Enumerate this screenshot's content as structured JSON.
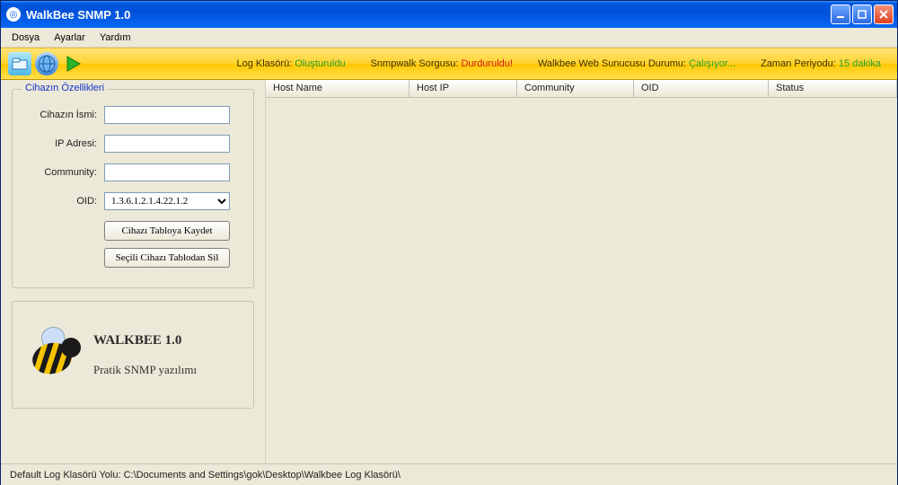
{
  "window": {
    "title": "WalkBee SNMP 1.0"
  },
  "menu": {
    "file": "Dosya",
    "settings": "Ayarlar",
    "help": "Yardım"
  },
  "toolbar": {
    "log_label": "Log Klasörü:",
    "log_value": "Oluşturuldu",
    "walk_label": "Snmpwalk Sorgusu:",
    "walk_value": "Durduruldu!",
    "web_label": "Walkbee Web Sunucusu Durumu:",
    "web_value": "Çalışıyor...",
    "period_label": "Zaman Periyodu:",
    "period_value": "15 dakika"
  },
  "form": {
    "group_title": "Cihazın Özellikleri",
    "name_label": "Cihazın İsmi:",
    "name_value": "",
    "ip_label": "IP Adresi:",
    "ip_value": "",
    "community_label": "Community:",
    "community_value": "",
    "oid_label": "OID:",
    "oid_value": "1.3.6.1.2.1.4.22.1.2",
    "save_btn": "Cihazı Tabloya Kaydet",
    "delete_btn": "Seçili Cihazı Tablodan Sil"
  },
  "branding": {
    "title": "WALKBEE 1.0",
    "subtitle": "Pratik SNMP yazılımı"
  },
  "table": {
    "columns": {
      "hostname": "Host Name",
      "hostip": "Host IP",
      "community": "Community",
      "oid": "OID",
      "status": "Status"
    }
  },
  "statusbar": {
    "text": "Default Log Klasörü Yolu: C:\\Documents and Settings\\gok\\Desktop\\Walkbee Log Klasörü\\"
  }
}
